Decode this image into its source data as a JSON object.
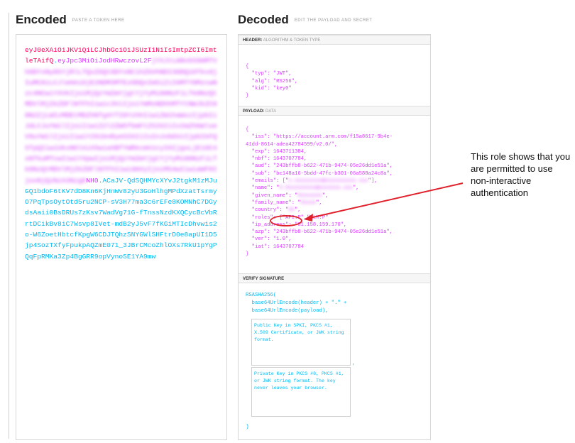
{
  "encoded": {
    "title": "Encoded",
    "subtitle": "PASTE A TOKEN HERE",
    "header_part": "eyJ0eXAiOiJKV1QiLCJhbGciOiJSUzI1NiIsImtpZCI6ImtleTAifQ",
    "payload_visible_start": "eyJpc3MiOiJodHRwczovL2F",
    "payload_blurred": "jYXJtLmNvbS9mMTVhODYxNy05YjRlLTQxZGQtODYxNC1hZGVhNDI3ODQ1OTkvdjIuMC8iLCJleHAiOjE2NDM3MTEzODQsIm5iZiI6MTY0MzcwNzc4NCwiYXVkIjoiMjQzYmZmYjgtYjYyMi00NzFiLTk0NzQtMDVlMjZkZDFlNTFhIiwic3ViIjoiYmMxNDhhMTYtNWJkZC00N2ZjLWIzMDEtMDZhNTg4YTI0YzhhIiwiZW1haWxzIjpbIiJdLCJuYW1lIjoiIiwiZ2l2ZW5fbmFtZSI6IiIsImZhbWlseV9uYW1lIjoiIiwiY291bnRyeSI6IiIsInJvbGVzIjpbIkFQSTpQIiwiUkxNOlAiXSwiaXBfYWRkcmVzcyI6IjgxLjE1OC4xNTkuMTcwIiwiYXpwIjoiMjQzYmZmYjgtYjYyMi00NzFiLTk0NzQtMDVlMjZkZDFlNTFhIiwidmVyIjoiMS4wIiwiaWF0IjoxNjQzNzA3Nzg0",
    "payload_visible_end": "NH0",
    "signature": "ACaJV-QdSQHMYcXYvJ2tgkM1zMJuGQ1bdoF6tKV7dD8Kn6KjHnWv82yU3GoHlhgMPdXzatTsrmyO7PqTpsOytOtd5ru2NCP-sV3H77ma3c6rEFe8KOMNhC7DGydsAaii0BsDRUs7zKsv7WadVg71G-fTnssNzdKXQCycBcVbRrtDCikBv8iC7Wsvp8IVet-mdB2yJ5vF7fKGiMTIcDhvwis2o-W6ZoetHbtcfKpgW6CDJTQhzSNYGWlSHFtrD0e8apUI1D5jp4SozTXfyFpukpAQZmE071_3JBrCMcoZhlOXs7RkU1pYgPQqFpRMKa3Zp4BgGRR9opVynoSE1YA9mw"
  },
  "decoded": {
    "title": "Decoded",
    "subtitle": "EDIT THE PAYLOAD AND SECRET",
    "header_section": {
      "label_bold": "HEADER:",
      "label_light": "ALGORITHM & TOKEN TYPE"
    },
    "header_lines": [
      "{",
      "  \"typ\": \"JWT\",",
      "  \"alg\": \"RS256\",",
      "  \"kid\": \"key0\"",
      "}"
    ],
    "payload_section": {
      "label_bold": "PAYLOAD:",
      "label_light": "DATA"
    },
    "payload_lines": [
      "{",
      "  \"iss\": \"https://account.arm.com/f15a8617-9b4e-",
      "41dd-8614-adea42784599/v2.0/\",",
      "  \"exp\": 1643711384,",
      "  \"nbf\": 1643707784,",
      "  \"aud\": \"243bffb8-b622-471b-9474-05e26dd1e51a\",",
      "  \"sub\": \"bc148a16-5bdd-47fc-b301-06a588a24c8a\",",
      "  \"emails\": [\"",
      "  \"name\": \"",
      "  \"given_name\": \"",
      "  \"family_name\": \"",
      "  \"country\": \"",
      "  \"roles\": [\"API:P\",\"RLM:P\"",
      "  \"ip_address\": \"81.158.159.170\",",
      "  \"azp\": \"243bffb8-b622-471b-9474-05e26dd1e51a\",",
      "  \"ver\": \"1.0\",",
      "  \"iat\": 1643707784",
      "}"
    ],
    "redacted": [
      "x.xxxxxxxxx@xxxxxxxxxx.xxx",
      "X.Xxxxxxxxxx@xxxxxxx.xxx",
      "Xxxxxxxx",
      "Xxxxx",
      "XX"
    ],
    "verify_section": {
      "label_bold": "VERIFY SIGNATURE"
    },
    "verify_lines": [
      "RSASHA256(",
      "  base64UrlEncode(header) + \".\" +",
      "  base64UrlEncode(payload),"
    ],
    "public_key_placeholder": "Public Key in SPKI, PKCS #1, X.509 Certificate, or JWK string format.",
    "private_key_placeholder": "Private Key in PKCS #8, PKCS #1, or JWK string format. The key never leaves your browser.",
    "closing_paren": ")",
    "comma": ","
  },
  "annotation": {
    "text": "This role shows that you are permitted to use non-interactive authentication",
    "color": "#e0202a"
  }
}
